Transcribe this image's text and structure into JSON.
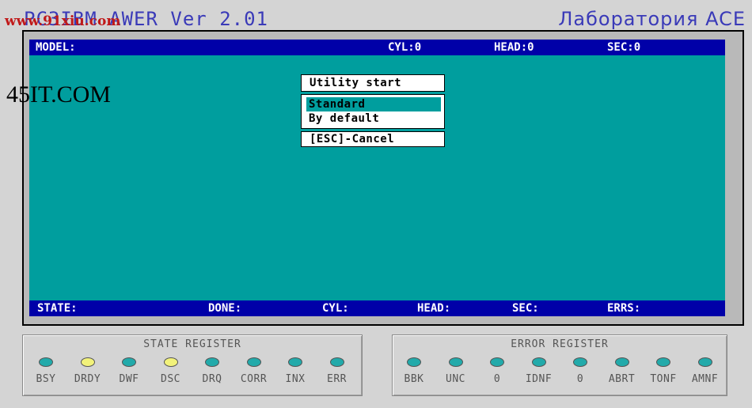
{
  "app": {
    "title": "PC3IBM AWER Ver 2.01",
    "lab": "Лаборатория ACE"
  },
  "watermarks": {
    "top": "www.91xiu.com",
    "side": "45IT.COM"
  },
  "status_top": {
    "model": "MODEL:",
    "cyl": "CYL:0",
    "head": "HEAD:0",
    "sec": "SEC:0"
  },
  "status_bottom": {
    "state": "STATE:",
    "done": "DONE:",
    "cyl": "CYL:",
    "head": "HEAD:",
    "sec": "SEC:",
    "errs": "ERRS:"
  },
  "dialog": {
    "title": "Utility start",
    "items": [
      "Standard",
      "By default"
    ],
    "selected_index": 0,
    "cancel": "[ESC]-Cancel"
  },
  "state_register": {
    "title": "STATE REGISTER",
    "leds": [
      {
        "label": "BSY",
        "on": false
      },
      {
        "label": "DRDY",
        "on": true
      },
      {
        "label": "DWF",
        "on": false
      },
      {
        "label": "DSC",
        "on": true
      },
      {
        "label": "DRQ",
        "on": false
      },
      {
        "label": "CORR",
        "on": false
      },
      {
        "label": "INX",
        "on": false
      },
      {
        "label": "ERR",
        "on": false
      }
    ]
  },
  "error_register": {
    "title": "ERROR REGISTER",
    "leds": [
      {
        "label": "BBK",
        "on": false
      },
      {
        "label": "UNC",
        "on": false
      },
      {
        "label": "0",
        "on": false
      },
      {
        "label": "IDNF",
        "on": false
      },
      {
        "label": "0",
        "on": false
      },
      {
        "label": "ABRT",
        "on": false
      },
      {
        "label": "TONF",
        "on": false
      },
      {
        "label": "AMNF",
        "on": false
      }
    ]
  },
  "colors": {
    "screen_bg": "#009e9e",
    "status_bar": "#0000a8",
    "led_on": "#f2f27a",
    "led_off": "#22aaaa",
    "title_text": "#3a3ab8"
  }
}
